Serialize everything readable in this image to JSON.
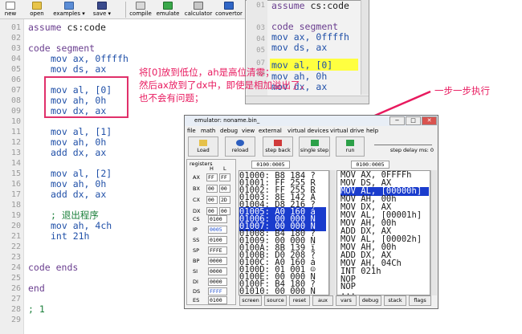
{
  "toolbar": {
    "buttons": [
      {
        "label": "new",
        "icon": "new-file-icon"
      },
      {
        "label": "open",
        "icon": "open-folder-icon"
      },
      {
        "label": "examples",
        "icon": "examples-icon"
      },
      {
        "label": "save",
        "icon": "save-disk-icon"
      },
      {
        "label": "compile",
        "icon": "compile-icon"
      },
      {
        "label": "emulate",
        "icon": "emulate-icon"
      },
      {
        "label": "calculator",
        "icon": "calculator-icon"
      },
      {
        "label": "convertor",
        "icon": "convertor-icon"
      }
    ]
  },
  "editor": {
    "line_numbers": [
      "01",
      "02",
      "03",
      "04",
      "05",
      "06",
      "07",
      "08",
      "09",
      "10",
      "11",
      "12",
      "13",
      "14",
      "15",
      "16",
      "17",
      "18",
      "19",
      "20",
      "21",
      "22",
      "23",
      "24",
      "25",
      "26",
      "27",
      "28",
      "29"
    ],
    "lines": {
      "l01a": "assume",
      "l01b": " cs:code",
      "l03a": "code",
      "l03b": " segment",
      "l04a": "mov",
      "l04b": " ax, 0ffffh",
      "l05a": "mov",
      "l05b": " ds, ax",
      "l07a": "mov",
      "l07b": " al, [0]",
      "l08a": "mov",
      "l08b": " ah, 0h",
      "l09a": "mov",
      "l09b": " dx, ax",
      "l11a": "mov",
      "l11b": " al, [1]",
      "l12a": "mov",
      "l12b": " ah, 0h",
      "l13a": "add",
      "l13b": " dx, ax",
      "l15a": "mov",
      "l15b": " al, [2]",
      "l16a": "mov",
      "l16b": " ah, 0h",
      "l17a": "add",
      "l17b": " dx, ax",
      "l19": "; 退出程序",
      "l20a": "mov",
      "l20b": " ah, 4ch",
      "l21a": "int",
      "l21b": " 21h",
      "l24a": "code",
      "l24b": " ends",
      "l26": "end",
      "l28": "; 1"
    }
  },
  "editor2": {
    "line_numbers": [
      "01",
      "02",
      "03",
      "04",
      "05",
      "06",
      "07",
      "08"
    ],
    "lines": {
      "a1": "assume",
      "b1": " cs:code",
      "a3": "code",
      "b3": " segment",
      "a4": "mov",
      "b4": " ax, 0ffffh",
      "a5": "mov",
      "b5": " ds, ax",
      "a7": "mov",
      "b7": " al, [0]",
      "a8": "mov",
      "b8": " ah, 0h",
      "a9": "mov",
      "b9": " dx, ax"
    }
  },
  "annotations": {
    "note1": "将[0]放到低位，ah是高位清零；",
    "note2": "然后ax放到了dx中，即使是相加溢出了，",
    "note3": "也不会有问题；",
    "note4": "一步一步执行"
  },
  "emulator": {
    "title": "emulator: noname.bin_",
    "window_buttons": [
      "−",
      "□",
      "✕"
    ],
    "menu": [
      "file",
      "math",
      "debug",
      "view",
      "external",
      "virtual devices",
      "virtual drive",
      "help"
    ],
    "tools": [
      {
        "label": "Load",
        "icon": "load-icon"
      },
      {
        "label": "reload",
        "icon": "reload-icon"
      },
      {
        "label": "step back",
        "icon": "step-back-icon"
      },
      {
        "label": "single step",
        "icon": "single-step-icon"
      },
      {
        "label": "run",
        "icon": "run-icon"
      }
    ],
    "step_delay": "step delay ms: 0",
    "registers_label": "registers",
    "reg_hl": [
      "H",
      "L"
    ],
    "regs_hl": [
      {
        "name": "AX",
        "h": "FF",
        "l": "FF"
      },
      {
        "name": "BX",
        "h": "00",
        "l": "00"
      },
      {
        "name": "CX",
        "h": "00",
        "l": "2D"
      },
      {
        "name": "DX",
        "h": "00",
        "l": "00"
      }
    ],
    "regs_full": [
      {
        "name": "CS",
        "value": "0100"
      },
      {
        "name": "IP",
        "value": "0005"
      },
      {
        "name": "SS",
        "value": "0100"
      },
      {
        "name": "SP",
        "value": "FFFE"
      },
      {
        "name": "BP",
        "value": "0000"
      },
      {
        "name": "SI",
        "value": "0000"
      },
      {
        "name": "DI",
        "value": "0000"
      },
      {
        "name": "DS",
        "value": "FFFF"
      },
      {
        "name": "ES",
        "value": "0100"
      }
    ],
    "address_boxes": [
      "0100:0005",
      "0100:0005"
    ],
    "memory": [
      "01000: B8 184 ?",
      "01001: FF 255 R",
      "01002: FF 255 R",
      "01003: 8E 142 Ä",
      "01004: D8 216 ?",
      "01005: A0 160 á",
      "01006: 00 000 N",
      "01007: 00 000 N",
      "01008: B4 180 ?",
      "01009: 00 000 N",
      "0100A: 8B 139 ï",
      "0100B: D0 208 ?",
      "0100C: A0 160 á",
      "0100D: 01 001 ☺",
      "0100E: 00 000 N",
      "0100F: B4 180 ?",
      "01010: 00 000 N"
    ],
    "disasm": [
      "MOV AX, 0FFFFh",
      "MOV DS, AX",
      "MOV AL, [00000h]",
      "MOV AH, 00h",
      "MOV DX, AX",
      "MOV AL, [00001h]",
      "MOV AH, 00h",
      "ADD DX, AX",
      "MOV AL, [00002h]",
      "MOV AH, 00h",
      "ADD DX, AX",
      "MOV AH, 04Ch",
      "INT 021h",
      "NOP",
      "NOP",
      "..."
    ],
    "bottom_buttons": [
      "screen",
      "source",
      "reset",
      "aux",
      "vars",
      "debug",
      "stack",
      "flags"
    ],
    "colors": {
      "selection": "#1a3ccd",
      "highlight": "#ffff40",
      "annotation": "#e8195e"
    }
  }
}
